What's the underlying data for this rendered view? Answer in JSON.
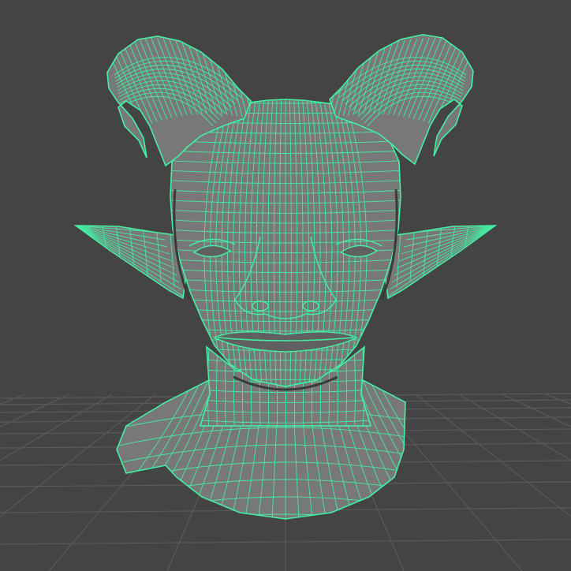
{
  "viewport": {
    "background_color": "#444444",
    "grid_color": "#5a5a5a",
    "mesh_fill_color": "#787878",
    "mesh_shadow_color": "#606060",
    "wireframe_color": "#44f0a4",
    "selection_state": "selected"
  },
  "model": {
    "object_icon": "head-bust-mesh-icon",
    "parts": [
      "left-horn",
      "right-horn",
      "left-ear",
      "right-ear",
      "head",
      "neck",
      "shoulders"
    ]
  }
}
